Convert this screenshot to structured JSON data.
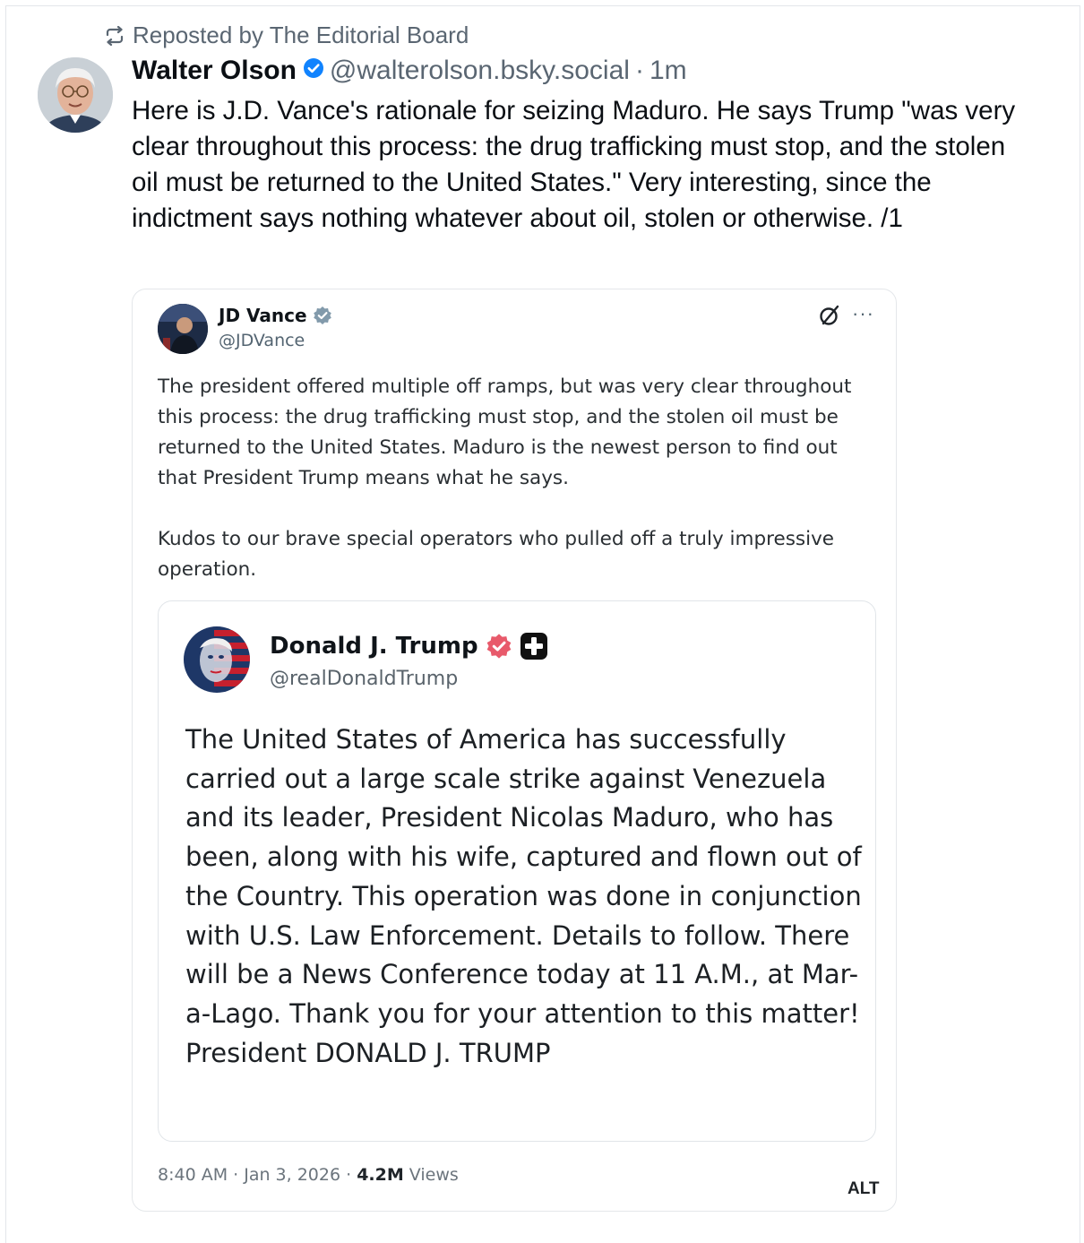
{
  "repost": {
    "label": "Reposted by The Editorial Board"
  },
  "post": {
    "author_name": "Walter Olson",
    "handle": "@walterolson.bsky.social",
    "separator": "·",
    "time": "1m",
    "text": "Here is J.D. Vance's rationale for seizing Maduro. He says Trump \"was very clear throughout this process: the drug trafficking must stop, and the stolen oil must be returned to the United States.\" Very interesting, since the indictment says nothing whatever about oil, stolen or otherwise. /1"
  },
  "embed": {
    "author_name": "JD Vance",
    "handle": "@JDVance",
    "text": "The president offered multiple off ramps, but was very clear throughout this process: the drug trafficking must stop, and the stolen oil must be returned to the United States. Maduro is the newest person to find out that President Trump means what he says.\n\nKudos to our brave special operators who pulled off a truly impressive operation.",
    "more_label": "···",
    "meta_time": "8:40 AM · Jan 3, 2026 · ",
    "meta_views_count": "4.2M",
    "meta_views_label": " Views",
    "alt_label": "ALT"
  },
  "quote": {
    "author_name": "Donald J. Trump",
    "handle": "@realDonaldTrump",
    "text": "The United States of America has successfully carried out a large scale strike against Venezuela and its leader, President Nicolas Maduro, who has been, along with his wife, captured and flown out of the Country. This operation was done in conjunction with U.S. Law Enforcement. Details to follow. There will be a News Conference today at 11 A.M., at Mar-a-Lago. Thank you for your attention to this matter! President DONALD J. TRUMP"
  },
  "icons": {
    "repost": "repost-icon",
    "verified": "verified-check-icon",
    "grok": "grok-icon",
    "more": "more-icon",
    "plus_badge": "plus-badge-icon"
  },
  "colors": {
    "bluesky_verified": "#1083fe",
    "truth_verified": "#e85a6b",
    "x_verified_gray": "#829aab",
    "muted_text": "#5a6672"
  }
}
